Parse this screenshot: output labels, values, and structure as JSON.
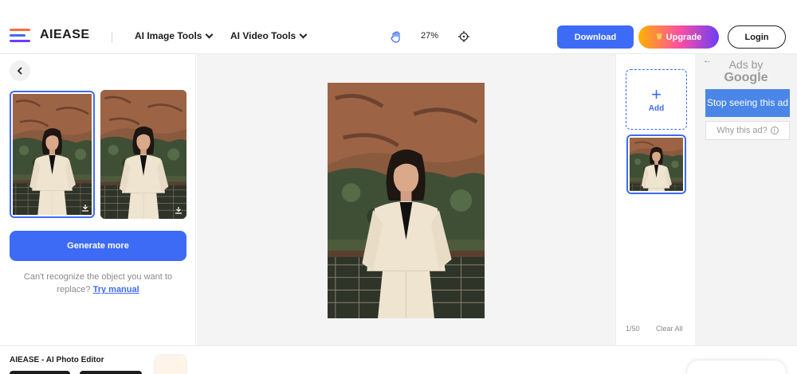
{
  "header": {
    "logo_text": "AIEASE",
    "nav": [
      {
        "label": "AI Image Tools"
      },
      {
        "label": "AI Video Tools"
      }
    ],
    "zoom": "27%",
    "download_label": "Download",
    "upgrade_label": "Upgrade",
    "login_label": "Login"
  },
  "left_panel": {
    "generate_label": "Generate more",
    "hint_text": "Can't recognize the object you want to replace?",
    "hint_link": "Try manual"
  },
  "right_panel": {
    "add_label": "Add",
    "count": "1/50",
    "clear_label": "Clear All"
  },
  "ad": {
    "ads_by": "Ads by",
    "google": "Google",
    "stop_label": "Stop seeing this ad",
    "why_label": "Why this ad?"
  },
  "bottom": {
    "title": "AIEASE - AI Photo Editor"
  },
  "colors": {
    "accent": "#3d6bf5",
    "upgrade_start": "#ffb300",
    "upgrade_end": "#6c3df5"
  }
}
